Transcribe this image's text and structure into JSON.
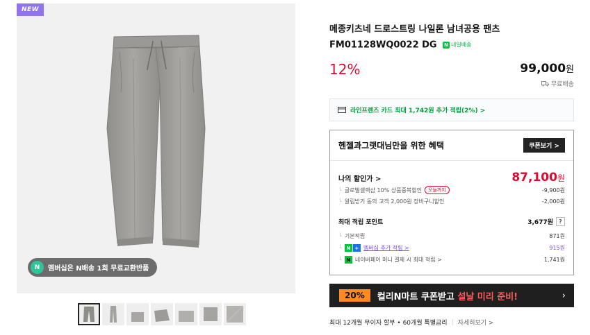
{
  "gallery": {
    "new_badge": "NEW",
    "member_banner": "멤버십은 N배송 1회 무료교환반품",
    "member_icon": "N",
    "thumb_count": 7,
    "pants_color": "#9e9d99"
  },
  "product": {
    "title": "메종키츠네 드로스트링 나일론 남녀공용 팬츠 FM01128WQ0022 DG",
    "delivery_tag": "내일배송",
    "delivery_tag_icon": "N",
    "discount": "12%",
    "price": "99,000",
    "won": "원",
    "shipping": "무료배송"
  },
  "card_promo": "라인프렌즈 카드 최대 1,742원 추가 적립(2%) >",
  "benefit": {
    "title": "헨젤과그랫대님만을 위한 혜택",
    "coupon_button": "쿠폰보기 >",
    "my_price_label": "나의 할인가 >",
    "my_price": "87,100",
    "discounts": [
      {
        "label": "글로벌셀렉샵 10% 상품중복할인",
        "pill": "오늘까지",
        "amount": "-9,900원"
      },
      {
        "label": "알림받기 동의 고객 2,000원 장바구니할인",
        "amount": "-2,000원"
      }
    ],
    "points_label": "최대 적립 포인트",
    "points_value": "3,677원",
    "points_help": "?",
    "points_rows": [
      {
        "label": "기본적립",
        "amount": "871원"
      },
      {
        "label": "멤버십 추가 적립 >",
        "amount": "915원"
      },
      {
        "label": "네이버페이 머니 결제 시 최대 적립 >",
        "amount": "1,741원"
      }
    ]
  },
  "banner": {
    "pct": "20%",
    "text_main": "컬리N마트 쿠폰받고 ",
    "text_hl": "설날 미리 준비!",
    "arrow": "›"
  },
  "installment": {
    "text": "최대 12개월 무이자 할부 • 60개월 특별금리",
    "more": "자세히보기 >"
  },
  "colors": {
    "accent_red": "#e1082e",
    "naver_green": "#00c73c",
    "member_purple": "#7b4ef0",
    "new_badge": "#8f73f0"
  }
}
